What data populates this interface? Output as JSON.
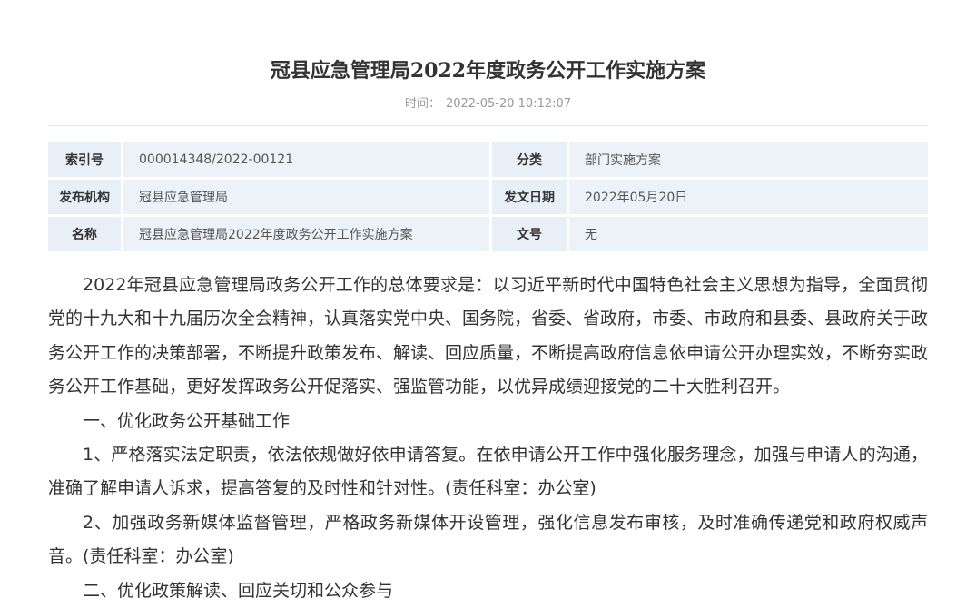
{
  "article": {
    "title": "冠县应急管理局2022年度政务公开工作实施方案",
    "time_label": "时间：",
    "time_value": "2022-05-20 10:12:07"
  },
  "info_table": {
    "rows": [
      {
        "k1": "索引号",
        "v1": "000014348/2022-00121",
        "k2": "分类",
        "v2": "部门实施方案"
      },
      {
        "k1": "发布机构",
        "v1": "冠县应急管理局",
        "k2": "发文日期",
        "v2": "2022年05月20日"
      },
      {
        "k1": "名称",
        "v1": "冠县应急管理局2022年度政务公开工作实施方案",
        "k2": "文号",
        "v2": "无"
      }
    ]
  },
  "content": {
    "paragraphs": [
      "2022年冠县应急管理局政务公开工作的总体要求是：以习近平新时代中国特色社会主义思想为指导，全面贯彻党的十九大和十九届历次全会精神，认真落实党中央、国务院，省委、省政府，市委、市政府和县委、县政府关于政务公开工作的决策部署，不断提升政策发布、解读、回应质量，不断提高政府信息依申请公开办理实效，不断夯实政务公开工作基础，更好发挥政务公开促落实、强监管功能，以优异成绩迎接党的二十大胜利召开。",
      "一、优化政务公开基础工作",
      "1、严格落实法定职责，依法依规做好依申请答复。在依申请公开工作中强化服务理念，加强与申请人的沟通，准确了解申请人诉求，提高答复的及时性和针对性。(责任科室：办公室)",
      "2、加强政务新媒体监督管理，严格政务新媒体开设管理，强化信息发布审核，及时准确传递党和政府权威声音。(责任科室：办公室)",
      "二、优化政策解读、回应关切和公众参与"
    ]
  }
}
